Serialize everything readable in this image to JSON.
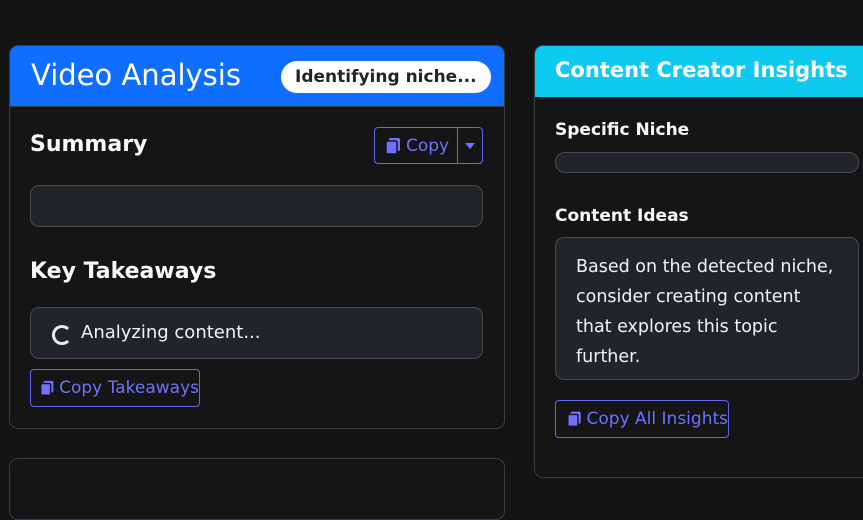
{
  "video": {
    "title": "Video Analysis",
    "status_pill": "Identifying niche...",
    "summary_heading": "Summary",
    "copy_label": "Copy",
    "summary_text": "",
    "takeaways_heading": "Key Takeaways",
    "analyzing_text": "Analyzing content...",
    "copy_takeaways_label": "Copy Takeaways"
  },
  "insights": {
    "title": "Content Creator Insights",
    "niche_heading": "Specific Niche",
    "niche_value": "",
    "ideas_heading": "Content Ideas",
    "ideas_text": "Based on the detected niche, consider creating content that explores this topic further.",
    "copy_all_label": "Copy All Insights"
  },
  "colors": {
    "primary": "#0f6efd",
    "info": "#0fcaf0",
    "outline_button": "#6366f1",
    "page_bg": "#141414"
  },
  "icons": [
    "copy-icon",
    "caret-down-icon",
    "spinner-icon"
  ]
}
